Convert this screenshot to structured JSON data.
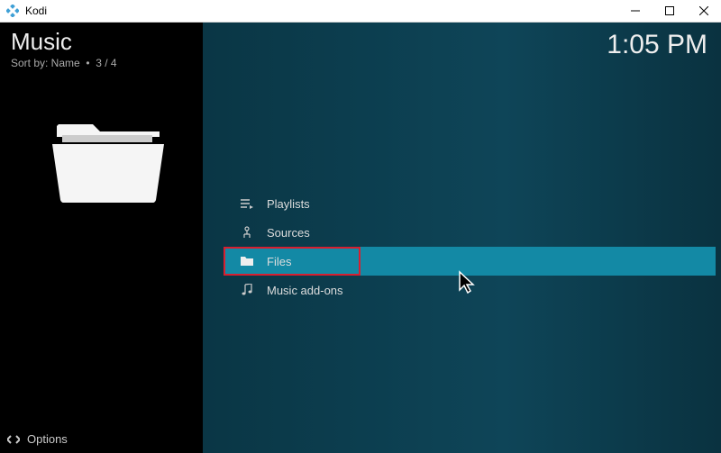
{
  "window": {
    "title": "Kodi"
  },
  "header": {
    "title": "Music",
    "sort_label": "Sort by: Name",
    "position": "3 / 4"
  },
  "clock": "1:05 PM",
  "menu": {
    "items": [
      {
        "label": "Playlists",
        "icon": "playlist-icon"
      },
      {
        "label": "Sources",
        "icon": "sources-icon"
      },
      {
        "label": "Files",
        "icon": "folder-icon"
      },
      {
        "label": "Music add-ons",
        "icon": "music-note-icon"
      }
    ]
  },
  "options": {
    "label": "Options"
  }
}
